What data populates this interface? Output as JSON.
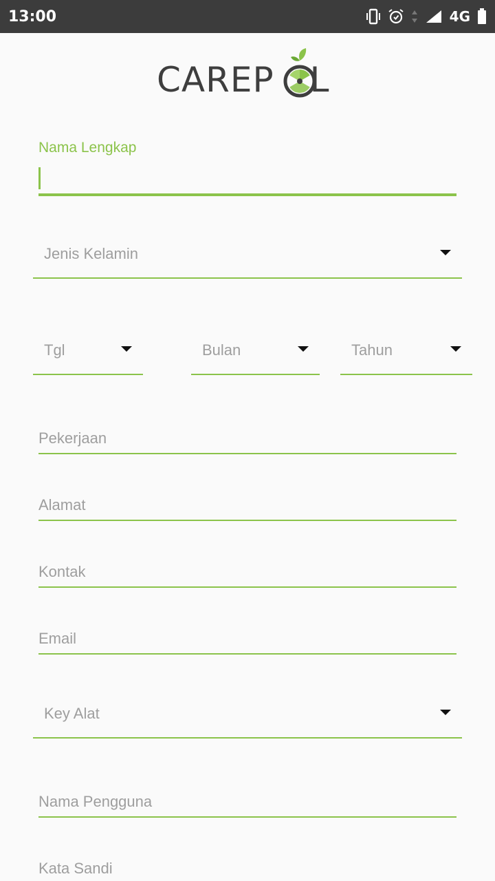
{
  "status_bar": {
    "time": "13:00",
    "network": "4G",
    "icons": [
      "vibrate-icon",
      "alarm-icon",
      "data-arrows-icon",
      "signal-icon",
      "battery-icon"
    ]
  },
  "app": {
    "logo_text": "CAREP",
    "logo_text_end": "L",
    "accent_color": "#8bc34a"
  },
  "form": {
    "full_name": {
      "label": "Nama Lengkap",
      "value": ""
    },
    "gender": {
      "placeholder": "Jenis Kelamin"
    },
    "birth_day": {
      "placeholder": "Tgl"
    },
    "birth_month": {
      "placeholder": "Bulan"
    },
    "birth_year": {
      "placeholder": "Tahun"
    },
    "occupation": {
      "placeholder": "Pekerjaan"
    },
    "address": {
      "placeholder": "Alamat"
    },
    "contact": {
      "placeholder": "Kontak"
    },
    "email": {
      "placeholder": "Email"
    },
    "device_key": {
      "placeholder": "Key Alat"
    },
    "username": {
      "placeholder": "Nama Pengguna"
    },
    "password": {
      "placeholder": "Kata Sandi"
    }
  }
}
